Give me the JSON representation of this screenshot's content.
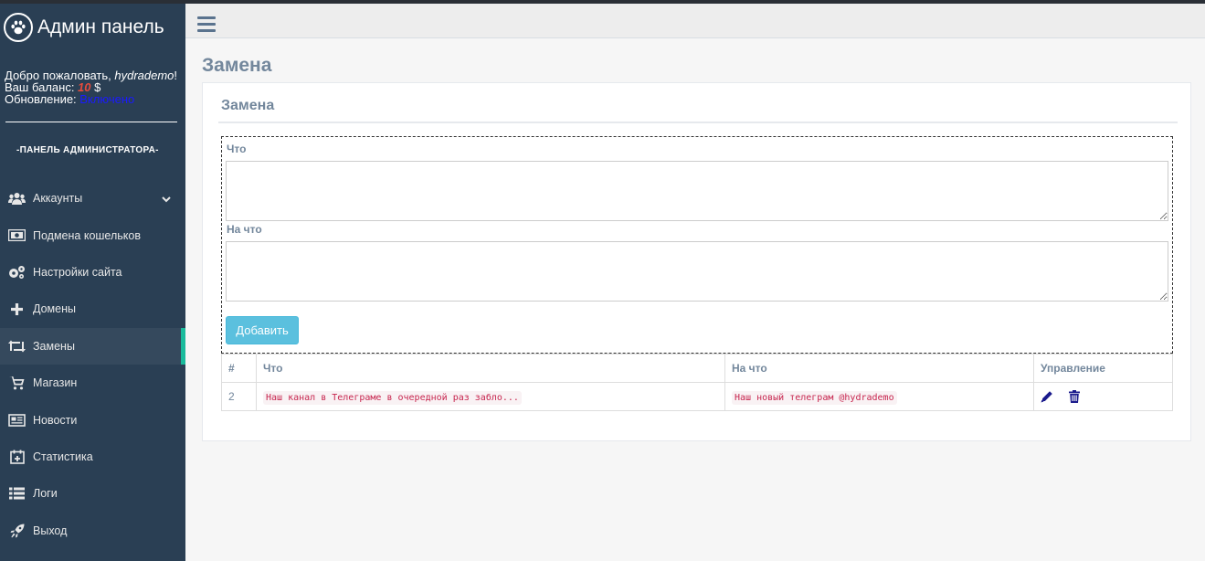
{
  "brand": {
    "title": "Админ панель",
    "logo_icon": "paw-icon"
  },
  "profile": {
    "welcome_prefix": "Добро пожаловать, ",
    "username": "hydrademo",
    "welcome_suffix": "!",
    "balance_label": "Ваш баланс: ",
    "balance_value": "10",
    "balance_currency": " $",
    "update_label": "Обновление: ",
    "update_value": "Включено"
  },
  "sidebar": {
    "section_title": "-ПАНЕЛЬ АДМИНИСТРАТОРА-",
    "items": [
      {
        "label": "Аккаунты",
        "icon": "users-icon",
        "has_submenu": true
      },
      {
        "label": "Подмена кошельков",
        "icon": "money-icon"
      },
      {
        "label": "Настройки сайта",
        "icon": "gears-icon"
      },
      {
        "label": "Домены",
        "icon": "plus-icon"
      },
      {
        "label": "Замены",
        "icon": "retweet-icon",
        "active": true
      },
      {
        "label": "Магазин",
        "icon": "cart-icon"
      },
      {
        "label": "Новости",
        "icon": "newspaper-icon"
      },
      {
        "label": "Статистика",
        "icon": "calendar-plus-icon"
      },
      {
        "label": "Логи",
        "icon": "list-icon"
      },
      {
        "label": "Выход",
        "icon": "rocket-icon"
      }
    ]
  },
  "page": {
    "title": "Замена"
  },
  "panel": {
    "title": "Замена",
    "form": {
      "what_label": "Что",
      "what_value": "",
      "to_label": "На что",
      "to_value": "",
      "add_button": "Добавить"
    },
    "table": {
      "headers": [
        "#",
        "Что",
        "На что",
        "Управление"
      ],
      "rows": [
        {
          "id": "2",
          "what": "Наш канал в Телеграме в очередной раз забло...",
          "to": "Наш новый телеграм @hydrademo"
        }
      ]
    }
  },
  "colors": {
    "sidebar_bg": "#2a3f54",
    "accent": "#1abb9c",
    "button": "#5bc0de",
    "title_text": "#73879c",
    "code_text": "#c7254e",
    "action_icon": "#1a1a8c"
  }
}
